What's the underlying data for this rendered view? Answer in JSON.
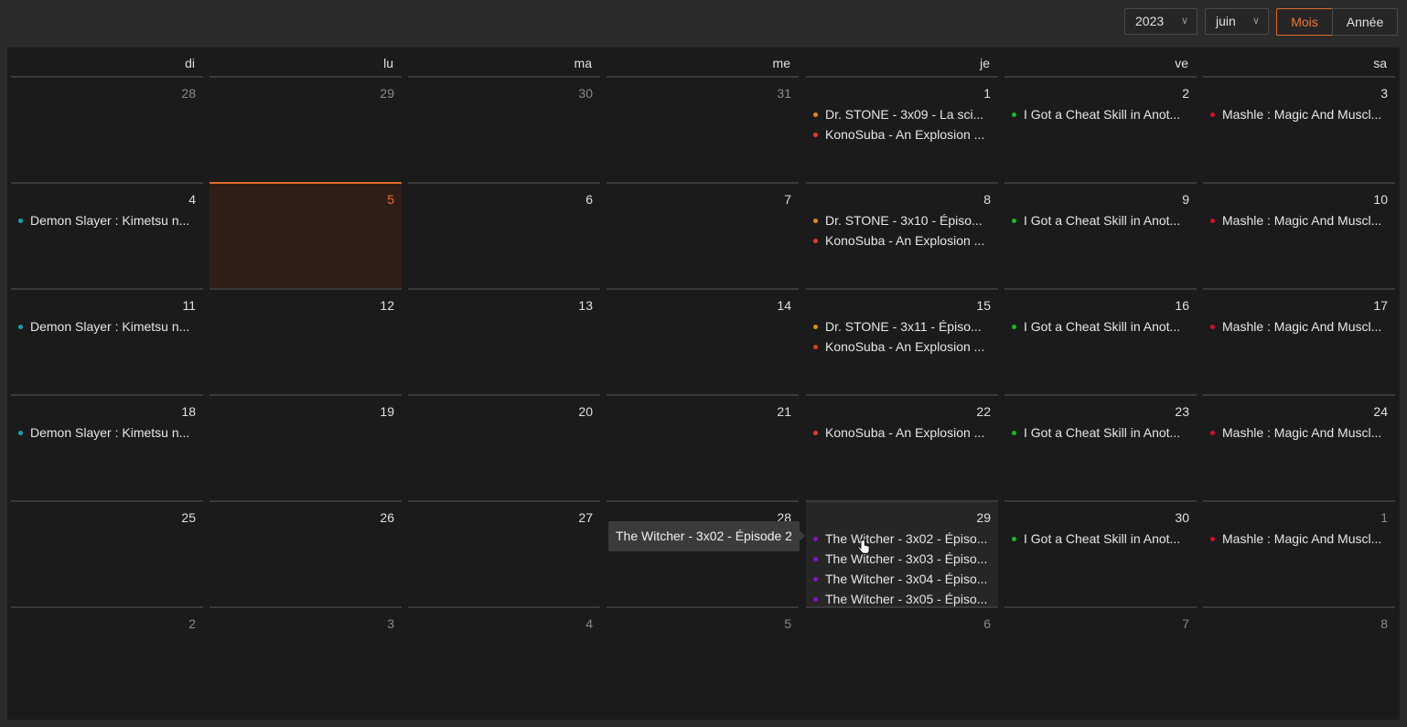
{
  "toolbar": {
    "year": "2023",
    "month": "juin",
    "view_month": "Mois",
    "view_year": "Année"
  },
  "colors": {
    "accent": "#e06a2a",
    "dr_stone": "#e08a1a",
    "konosuba": "#e0401a",
    "cheat_skill": "#1ab82a",
    "mashle": "#d0102a",
    "demon_slayer": "#1aa0b8",
    "witcher": "#8a10c8"
  },
  "weekdays": [
    "di",
    "lu",
    "ma",
    "me",
    "je",
    "ve",
    "sa"
  ],
  "weeks": [
    [
      {
        "day": "28",
        "other": true,
        "events": []
      },
      {
        "day": "29",
        "other": true,
        "events": []
      },
      {
        "day": "30",
        "other": true,
        "events": []
      },
      {
        "day": "31",
        "other": true,
        "events": []
      },
      {
        "day": "1",
        "events": [
          {
            "title": "Dr. STONE - 3x09 - La sci...",
            "color": "#e08a1a"
          },
          {
            "title": "KonoSuba - An Explosion ...",
            "color": "#e0401a"
          }
        ]
      },
      {
        "day": "2",
        "events": [
          {
            "title": "I Got a Cheat Skill in Anot...",
            "color": "#1ab82a"
          }
        ]
      },
      {
        "day": "3",
        "events": [
          {
            "title": "Mashle : Magic And Muscl...",
            "color": "#d0102a"
          }
        ]
      }
    ],
    [
      {
        "day": "4",
        "events": [
          {
            "title": "Demon Slayer : Kimetsu n...",
            "color": "#1aa0b8"
          }
        ]
      },
      {
        "day": "5",
        "today": true,
        "events": []
      },
      {
        "day": "6",
        "events": []
      },
      {
        "day": "7",
        "events": []
      },
      {
        "day": "8",
        "events": [
          {
            "title": "Dr. STONE - 3x10 - Épiso...",
            "color": "#e08a1a"
          },
          {
            "title": "KonoSuba - An Explosion ...",
            "color": "#e0401a"
          }
        ]
      },
      {
        "day": "9",
        "events": [
          {
            "title": "I Got a Cheat Skill in Anot...",
            "color": "#1ab82a"
          }
        ]
      },
      {
        "day": "10",
        "events": [
          {
            "title": "Mashle : Magic And Muscl...",
            "color": "#d0102a"
          }
        ]
      }
    ],
    [
      {
        "day": "11",
        "events": [
          {
            "title": "Demon Slayer : Kimetsu n...",
            "color": "#1aa0b8"
          }
        ]
      },
      {
        "day": "12",
        "events": []
      },
      {
        "day": "13",
        "events": []
      },
      {
        "day": "14",
        "events": []
      },
      {
        "day": "15",
        "events": [
          {
            "title": "Dr. STONE - 3x11 - Épiso...",
            "color": "#e08a1a"
          },
          {
            "title": "KonoSuba - An Explosion ...",
            "color": "#e0401a"
          }
        ]
      },
      {
        "day": "16",
        "events": [
          {
            "title": "I Got a Cheat Skill in Anot...",
            "color": "#1ab82a"
          }
        ]
      },
      {
        "day": "17",
        "events": [
          {
            "title": "Mashle : Magic And Muscl...",
            "color": "#d0102a"
          }
        ]
      }
    ],
    [
      {
        "day": "18",
        "events": [
          {
            "title": "Demon Slayer : Kimetsu n...",
            "color": "#1aa0b8"
          }
        ]
      },
      {
        "day": "19",
        "events": []
      },
      {
        "day": "20",
        "events": []
      },
      {
        "day": "21",
        "events": []
      },
      {
        "day": "22",
        "events": [
          {
            "title": "KonoSuba - An Explosion ...",
            "color": "#e0401a"
          }
        ]
      },
      {
        "day": "23",
        "events": [
          {
            "title": "I Got a Cheat Skill in Anot...",
            "color": "#1ab82a"
          }
        ]
      },
      {
        "day": "24",
        "events": [
          {
            "title": "Mashle : Magic And Muscl...",
            "color": "#d0102a"
          }
        ]
      }
    ],
    [
      {
        "day": "25",
        "events": []
      },
      {
        "day": "26",
        "events": []
      },
      {
        "day": "27",
        "events": []
      },
      {
        "day": "28",
        "events": []
      },
      {
        "day": "29",
        "hover": true,
        "events": [
          {
            "title": "The Witcher - 3x02 - Épiso...",
            "color": "#8a10c8"
          },
          {
            "title": "The Witcher - 3x03 - Épiso...",
            "color": "#8a10c8"
          },
          {
            "title": "The Witcher - 3x04 - Épiso...",
            "color": "#8a10c8"
          },
          {
            "title": "The Witcher - 3x05 - Épiso...",
            "color": "#8a10c8"
          }
        ]
      },
      {
        "day": "30",
        "events": [
          {
            "title": "I Got a Cheat Skill in Anot...",
            "color": "#1ab82a"
          }
        ]
      },
      {
        "day": "1",
        "other": true,
        "events": [
          {
            "title": "Mashle : Magic And Muscl...",
            "color": "#d0102a"
          }
        ]
      }
    ],
    [
      {
        "day": "2",
        "other": true,
        "events": []
      },
      {
        "day": "3",
        "other": true,
        "events": []
      },
      {
        "day": "4",
        "other": true,
        "events": []
      },
      {
        "day": "5",
        "other": true,
        "events": []
      },
      {
        "day": "6",
        "other": true,
        "events": []
      },
      {
        "day": "7",
        "other": true,
        "events": []
      },
      {
        "day": "8",
        "other": true,
        "events": []
      }
    ]
  ],
  "tooltip": {
    "text": "The Witcher - 3x02 - Épisode 2"
  }
}
